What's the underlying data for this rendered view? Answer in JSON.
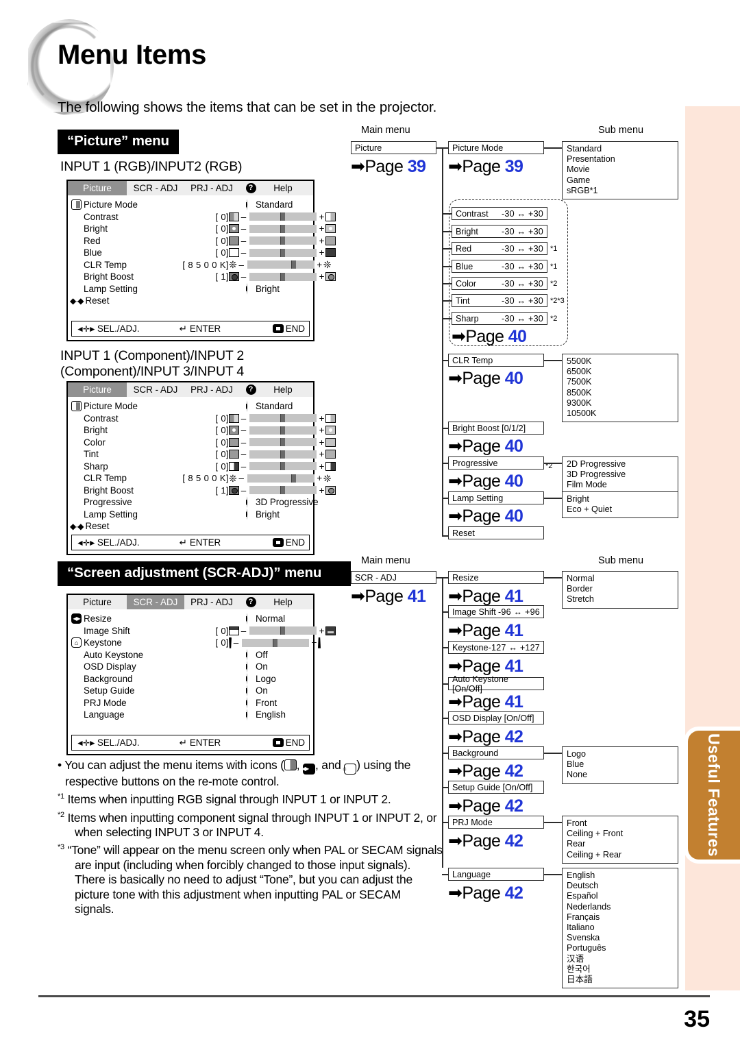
{
  "page": {
    "title": "Menu Items",
    "intro": "The following shows the items that can be set in the projector.",
    "number": "35",
    "side_tab": "Useful Features",
    "accent_blue": "#2035d6",
    "tab_brown": "#c28030",
    "band_peach": "#fde6da"
  },
  "sections": {
    "picture_banner": "“Picture” menu",
    "scr_banner": "“Screen adjustment (SCR-ADJ)” menu",
    "caption_rgb": "INPUT 1 (RGB)/INPUT2 (RGB)",
    "caption_comp_l1": "INPUT 1 (Component)/INPUT 2",
    "caption_comp_l2": "(Component)/INPUT 3/INPUT 4"
  },
  "osd": {
    "tabs": {
      "picture": "Picture",
      "scr": "SCR - ADJ",
      "prj": "PRJ - ADJ",
      "help_icon": "?",
      "help": "Help"
    },
    "footer": {
      "sel": "SEL./ADJ.",
      "enter": "ENTER",
      "end": "END"
    },
    "reset": "Reset",
    "menu1": {
      "selected_tab": "Picture",
      "rows": [
        {
          "label": "Picture Mode",
          "type": "arrow",
          "value": "Standard",
          "icon": "picture-mode-icon"
        },
        {
          "label": "Contrast",
          "bracket": "[            0]",
          "type": "slider",
          "knob": 46,
          "icon_left": "contrast-low-icon",
          "icon_right": "contrast-high-icon"
        },
        {
          "label": "Bright",
          "bracket": "[            0]",
          "type": "slider",
          "knob": 46,
          "icon_left": "bright-low-icon",
          "icon_right": "bright-high-icon"
        },
        {
          "label": "Red",
          "bracket": "[            0]",
          "type": "slider",
          "knob": 46,
          "icon_left": "red-low-icon",
          "icon_right": "red-high-icon"
        },
        {
          "label": "Blue",
          "bracket": "[            0]",
          "type": "slider",
          "knob": 46,
          "icon_left": "blue-low-icon",
          "icon_right": "blue-high-icon"
        },
        {
          "label": "CLR Temp",
          "bracket": "[    8 5 0 0 K]",
          "type": "slider",
          "knob": 66,
          "icon_left": "clr-temp-icon",
          "icon_right": "clr-temp-icon"
        },
        {
          "label": "Bright Boost",
          "bracket": "[            1]",
          "type": "slider",
          "knob": 46,
          "icon_left": "bright-boost-low-icon",
          "icon_right": "bright-boost-high-icon"
        },
        {
          "label": "Lamp Setting",
          "type": "arrow",
          "value": "Bright"
        }
      ]
    },
    "menu2": {
      "selected_tab": "Picture",
      "rows": [
        {
          "label": "Picture Mode",
          "type": "arrow",
          "value": "Standard",
          "icon": "picture-mode-icon"
        },
        {
          "label": "Contrast",
          "bracket": "[            0]",
          "type": "slider",
          "knob": 46
        },
        {
          "label": "Bright",
          "bracket": "[            0]",
          "type": "slider",
          "knob": 46
        },
        {
          "label": "Color",
          "bracket": "[            0]",
          "type": "slider",
          "knob": 46
        },
        {
          "label": "Tint",
          "bracket": "[            0]",
          "type": "slider",
          "knob": 46
        },
        {
          "label": "Sharp",
          "bracket": "[            0]",
          "type": "slider",
          "knob": 46
        },
        {
          "label": "CLR Temp",
          "bracket": "[    8 5 0 0 K]",
          "type": "slider",
          "knob": 66
        },
        {
          "label": "Bright Boost",
          "bracket": "[            1]",
          "type": "slider",
          "knob": 46
        },
        {
          "label": "Progressive",
          "type": "arrow",
          "value": "3D Progressive"
        },
        {
          "label": "Lamp Setting",
          "type": "arrow",
          "value": "Bright"
        }
      ]
    },
    "menu3": {
      "selected_tab": "SCR - ADJ",
      "rows": [
        {
          "label": "Resize",
          "type": "arrow",
          "value": "Normal",
          "icon": "resize-icon"
        },
        {
          "label": "Image Shift",
          "bracket": "[            0]",
          "type": "slider",
          "knob": 46
        },
        {
          "label": "Keystone",
          "bracket": "[            0]",
          "type": "slider",
          "knob": 46,
          "icon": "keystone-icon"
        },
        {
          "label": "Auto Keystone",
          "type": "arrow",
          "value": "Off"
        },
        {
          "label": "OSD Display",
          "type": "arrow",
          "value": "On"
        },
        {
          "label": "Background",
          "type": "arrow",
          "value": "Logo"
        },
        {
          "label": "Setup Guide",
          "type": "arrow",
          "value": "On"
        },
        {
          "label": "PRJ Mode",
          "type": "arrow",
          "value": "Front"
        },
        {
          "label": "Language",
          "type": "arrow",
          "value": "English"
        }
      ]
    }
  },
  "flow": {
    "headers": {
      "main": "Main menu",
      "sub": "Sub menu"
    },
    "picture": {
      "main": {
        "label": "Picture",
        "page": "39"
      },
      "picture_mode": {
        "label": "Picture Mode",
        "page": "39"
      },
      "picture_mode_sub": "Standard\nPresentation\nMovie\nGame\nsRGB*1",
      "adjust_group": [
        {
          "label": "Contrast",
          "range": "-30 ↔ +30",
          "note": ""
        },
        {
          "label": "Bright",
          "range": "-30 ↔ +30",
          "note": ""
        },
        {
          "label": "Red",
          "range": "-30 ↔ +30",
          "note": "*1"
        },
        {
          "label": "Blue",
          "range": "-30 ↔ +30",
          "note": "*1"
        },
        {
          "label": "Color",
          "range": "-30 ↔ +30",
          "note": "*2"
        },
        {
          "label": "Tint",
          "range": "-30 ↔ +30",
          "note": "*2*3"
        },
        {
          "label": "Sharp",
          "range": "-30 ↔ +30",
          "note": "*2"
        }
      ],
      "adjust_page": "40",
      "clr_temp": {
        "label": "CLR Temp",
        "page": "40"
      },
      "clr_temp_sub": "5500K\n6500K\n7500K\n8500K\n9300K\n10500K",
      "bright_boost": {
        "label": "Bright Boost [0/1/2]",
        "page": "40"
      },
      "progressive": {
        "label": "Progressive",
        "page": "40",
        "note": "*2"
      },
      "progressive_sub": "2D Progressive\n3D Progressive\nFilm Mode",
      "lamp_setting": {
        "label": "Lamp Setting",
        "page": "40"
      },
      "lamp_setting_sub": "Bright\nEco + Quiet",
      "reset": {
        "label": "Reset"
      }
    },
    "scradj": {
      "main": {
        "label": "SCR - ADJ",
        "page": "41"
      },
      "resize": {
        "label": "Resize",
        "page": "41"
      },
      "resize_sub": "Normal\nBorder\nStretch",
      "image_shift": {
        "label": "Image Shift",
        "range": "-96 ↔ +96",
        "page": "41"
      },
      "keystone": {
        "label": "Keystone",
        "range": "-127 ↔ +127",
        "page": "41"
      },
      "auto_keystone": {
        "label": "Auto Keystone [On/Off]",
        "page": "41"
      },
      "osd_display": {
        "label": "OSD Display [On/Off]",
        "page": "42"
      },
      "background": {
        "label": "Background",
        "page": "42"
      },
      "background_sub": "Logo\nBlue\nNone",
      "setup_guide": {
        "label": "Setup Guide [On/Off]",
        "page": "42"
      },
      "prj_mode": {
        "label": "PRJ Mode",
        "page": "42"
      },
      "prj_mode_sub": "Front\nCeiling + Front\nRear\nCeiling + Rear",
      "language": {
        "label": "Language",
        "page": "42"
      },
      "language_sub": "English\nDeutsch\nEspañol\nNederlands\nFrançais\nItaliano\nSvenska\nPortuguês\n汉语\n한국어\n日本語"
    }
  },
  "notes": {
    "bullet_a": "You can adjust the menu items with icons (",
    "bullet_b": ", ",
    "bullet_c": ", and ",
    "bullet_d": ") using the respective buttons on the re-mote control.",
    "n1": "Items when inputting RGB signal through INPUT 1 or INPUT 2.",
    "n2": "Items when inputting component signal through INPUT 1 or INPUT 2, or when selecting INPUT 3 or INPUT 4.",
    "n3": "“Tone” will appear on the menu screen only when PAL or SECAM signals are input (including when forcibly changed to those input signals). There is basically no need to adjust “Tone”, but you can adjust the picture tone with this adjustment when inputting PAL or SECAM signals.",
    "m1": "*1",
    "m2": "*2",
    "m3": "*3"
  }
}
